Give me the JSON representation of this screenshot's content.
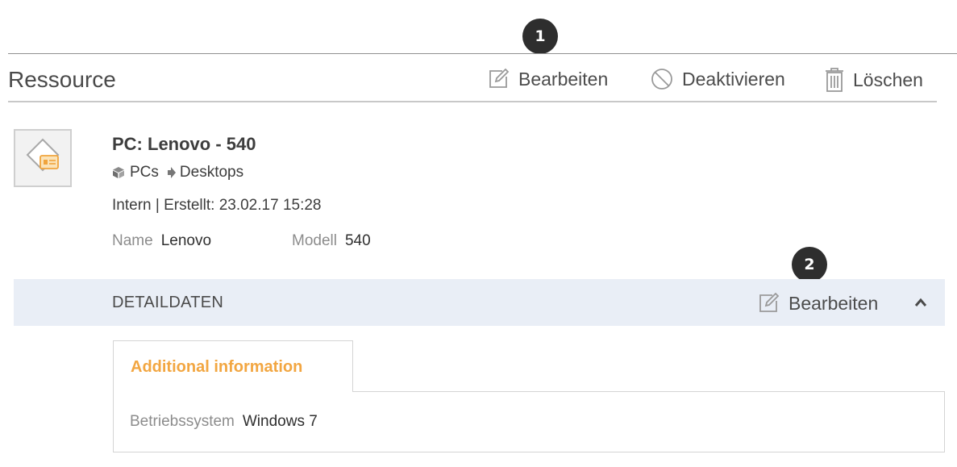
{
  "callouts": [
    "1",
    "2"
  ],
  "header": {
    "title": "Ressource",
    "actions": {
      "edit": {
        "label": "Bearbeiten",
        "icon": "edit-icon"
      },
      "deactivate": {
        "label": "Deaktivieren",
        "icon": "ban-icon"
      },
      "delete": {
        "label": "Löschen",
        "icon": "trash-icon"
      }
    }
  },
  "resource": {
    "thumbnail_icon": "resource-card-icon",
    "title": "PC: Lenovo - 540",
    "breadcrumb": [
      {
        "label": "PCs",
        "icon": "cube-icon"
      },
      {
        "label": "Desktops",
        "icon": "arrow-right-icon"
      }
    ],
    "meta": "Intern | Erstellt: 23.02.17 15:28",
    "attributes": [
      {
        "label": "Name",
        "value": "Lenovo"
      },
      {
        "label": "Modell",
        "value": "540"
      }
    ]
  },
  "details": {
    "title": "DETAILDATEN",
    "edit_label": "Bearbeiten",
    "collapse_icon": "chevron-up-icon",
    "tabs": [
      {
        "label": "Additional information",
        "active": true
      }
    ],
    "fields": [
      {
        "label": "Betriebssystem",
        "value": "Windows 7"
      }
    ]
  },
  "colors": {
    "accent": "#f2a641",
    "detail_bar": "#e9eef6",
    "callout": "#2e2e2e",
    "text": "#3d3d3d",
    "muted": "#8c8c8c"
  }
}
